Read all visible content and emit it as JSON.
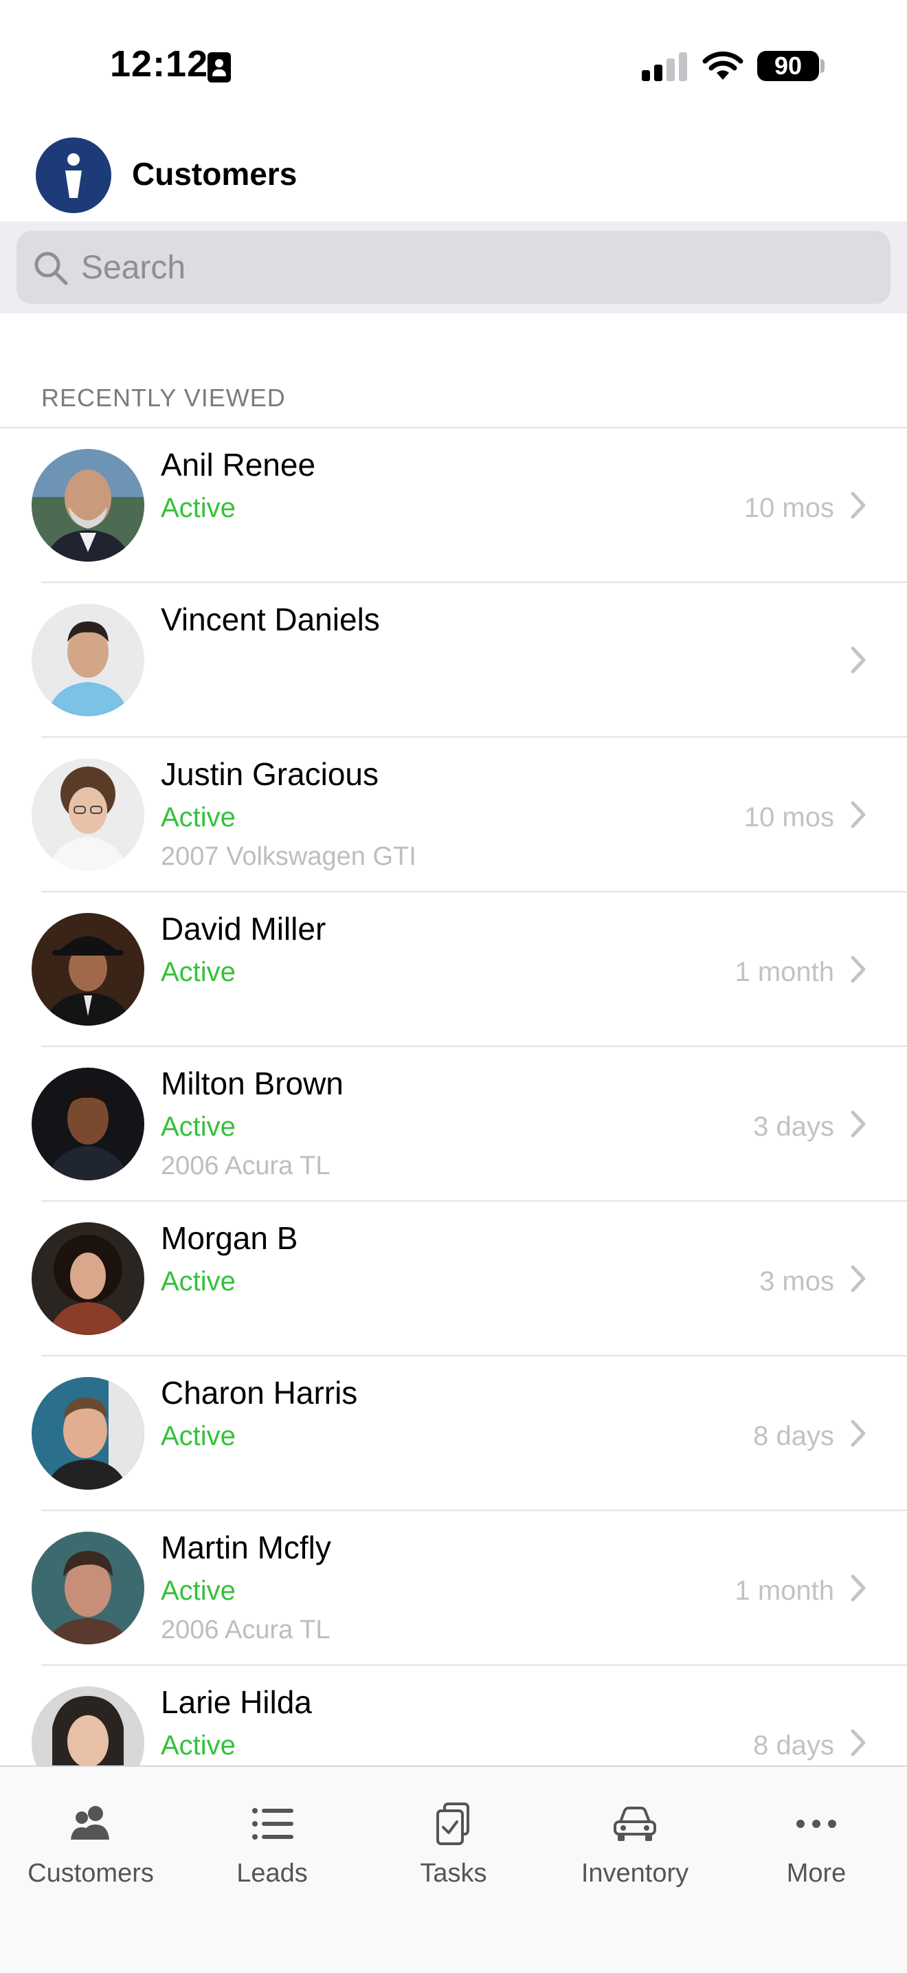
{
  "status_bar": {
    "time": "12:12",
    "battery": "90"
  },
  "header": {
    "title": "Customers"
  },
  "search": {
    "placeholder": "Search"
  },
  "section": {
    "title": "RECENTLY VIEWED"
  },
  "customers": [
    {
      "name": "Anil Renee",
      "status": "Active",
      "vehicle": "",
      "time": "10 mos"
    },
    {
      "name": "Vincent Daniels",
      "status": "",
      "vehicle": "",
      "time": ""
    },
    {
      "name": "Justin Gracious",
      "status": "Active",
      "vehicle": "2007 Volkswagen GTI",
      "time": "10 mos"
    },
    {
      "name": "David Miller",
      "status": "Active",
      "vehicle": "",
      "time": "1 month"
    },
    {
      "name": "Milton Brown",
      "status": "Active",
      "vehicle": "2006 Acura TL",
      "time": "3 days"
    },
    {
      "name": "Morgan B",
      "status": "Active",
      "vehicle": "",
      "time": "3 mos"
    },
    {
      "name": "Charon Harris",
      "status": "Active",
      "vehicle": "",
      "time": "8 days"
    },
    {
      "name": "Martin Mcfly",
      "status": "Active",
      "vehicle": "2006 Acura TL",
      "time": "1 month"
    },
    {
      "name": "Larie Hilda",
      "status": "Active",
      "vehicle": "",
      "time": "8 days"
    }
  ],
  "tabs": [
    {
      "label": "Customers",
      "icon": "people-icon"
    },
    {
      "label": "Leads",
      "icon": "list-icon"
    },
    {
      "label": "Tasks",
      "icon": "clipboard-check-icon"
    },
    {
      "label": "Inventory",
      "icon": "car-icon"
    },
    {
      "label": "More",
      "icon": "ellipsis-icon"
    }
  ],
  "colors": {
    "active_status": "#34c23a",
    "brand": "#1c3b78"
  }
}
